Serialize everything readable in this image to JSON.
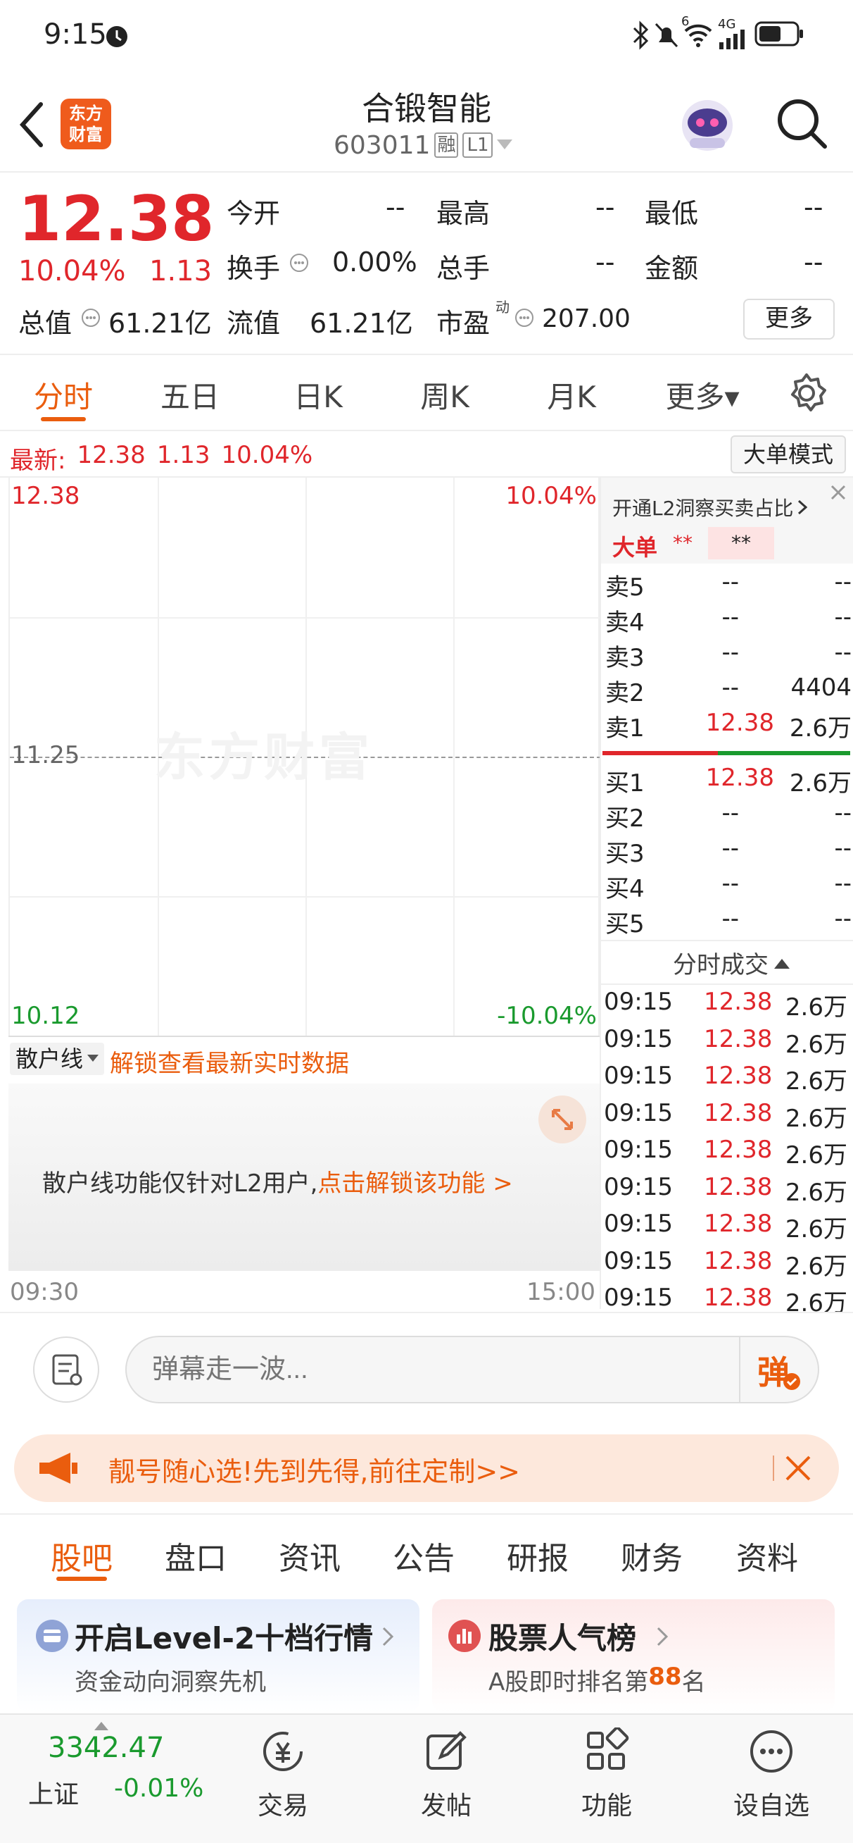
{
  "status": {
    "time": "9:15",
    "icons": [
      "alarm-icon",
      "bluetooth-icon",
      "mute-icon",
      "wifi-icon",
      "signal-icon",
      "battery-icon"
    ],
    "net": "4G",
    "wifi_badge": "6"
  },
  "header": {
    "title": "合锻智能",
    "code": "603011",
    "badge_rong": "融",
    "badge_level": "L1",
    "logo_line1": "东方",
    "logo_line2": "财富"
  },
  "quote": {
    "price": "12.38",
    "pct": "10.04%",
    "change": "1.13",
    "rows": [
      {
        "label": "今开",
        "value": "--"
      },
      {
        "label": "最高",
        "value": "--"
      },
      {
        "label": "最低",
        "value": "--"
      },
      {
        "label": "换手",
        "value": "0.00%"
      },
      {
        "label": "总手",
        "value": "--"
      },
      {
        "label": "金额",
        "value": "--"
      },
      {
        "label": "总值",
        "value": "61.21亿"
      },
      {
        "label": "流值",
        "value": "61.21亿"
      },
      {
        "label": "市盈",
        "sup": "动",
        "value": "207.00"
      }
    ],
    "more_btn": "更多"
  },
  "tabs": [
    "分时",
    "五日",
    "日K",
    "周K",
    "月K",
    "更多▾"
  ],
  "latest": {
    "label": "最新:",
    "price": "12.38",
    "change": "1.13",
    "pct": "10.04%",
    "mode_btn": "大单模式"
  },
  "chart": {
    "top_price": "12.38",
    "top_pct": "10.04%",
    "mid_price": "11.25",
    "bot_price": "10.12",
    "bot_pct": "-10.04%",
    "watermark": "东方财富",
    "start_time": "09:30",
    "end_time": "15:00",
    "retail_select": "散户线",
    "retail_unlock": "解锁查看最新实时数据",
    "l2_notice": "散户线功能仅针对L2用户,",
    "l2_link": "点击解锁该功能 >"
  },
  "orderbook": {
    "promo": "开通L2洞察买卖占比",
    "big_label": "大单",
    "big_v1": "**",
    "big_v2": "**",
    "sells": [
      {
        "label": "卖5",
        "price": "--",
        "vol": "--"
      },
      {
        "label": "卖4",
        "price": "--",
        "vol": "--"
      },
      {
        "label": "卖3",
        "price": "--",
        "vol": "--"
      },
      {
        "label": "卖2",
        "price": "--",
        "vol": "4404"
      },
      {
        "label": "卖1",
        "price": "12.38",
        "vol": "2.6万"
      }
    ],
    "buys": [
      {
        "label": "买1",
        "price": "12.38",
        "vol": "2.6万"
      },
      {
        "label": "买2",
        "price": "--",
        "vol": "--"
      },
      {
        "label": "买3",
        "price": "--",
        "vol": "--"
      },
      {
        "label": "买4",
        "price": "--",
        "vol": "--"
      },
      {
        "label": "买5",
        "price": "--",
        "vol": "--"
      }
    ],
    "trades_title": "分时成交",
    "trades": [
      {
        "t": "09:15",
        "p": "12.38",
        "v": "2.6万"
      },
      {
        "t": "09:15",
        "p": "12.38",
        "v": "2.6万"
      },
      {
        "t": "09:15",
        "p": "12.38",
        "v": "2.6万"
      },
      {
        "t": "09:15",
        "p": "12.38",
        "v": "2.6万"
      },
      {
        "t": "09:15",
        "p": "12.38",
        "v": "2.6万"
      },
      {
        "t": "09:15",
        "p": "12.38",
        "v": "2.6万"
      },
      {
        "t": "09:15",
        "p": "12.38",
        "v": "2.6万"
      },
      {
        "t": "09:15",
        "p": "12.38",
        "v": "2.6万"
      },
      {
        "t": "09:15",
        "p": "12.38",
        "v": "2.6万"
      }
    ]
  },
  "comment": {
    "placeholder": "弹幕走一波...",
    "send": "弹"
  },
  "banner": {
    "text": "靓号随心选!先到先得,前往定制>>"
  },
  "section_tabs": [
    "股吧",
    "盘口",
    "资讯",
    "公告",
    "研报",
    "财务",
    "资料"
  ],
  "cards": [
    {
      "title": "开启Level-2十档行情",
      "sub": "资金动向洞察先机"
    },
    {
      "title": "股票人气榜",
      "sub_pre": "A股即时排名第",
      "sub_num": "88",
      "sub_post": "名"
    }
  ],
  "bottom": {
    "index_value": "3342.47",
    "index_name": "上证",
    "index_pct": "-0.01%",
    "items": [
      "交易",
      "发帖",
      "功能",
      "设自选"
    ]
  }
}
